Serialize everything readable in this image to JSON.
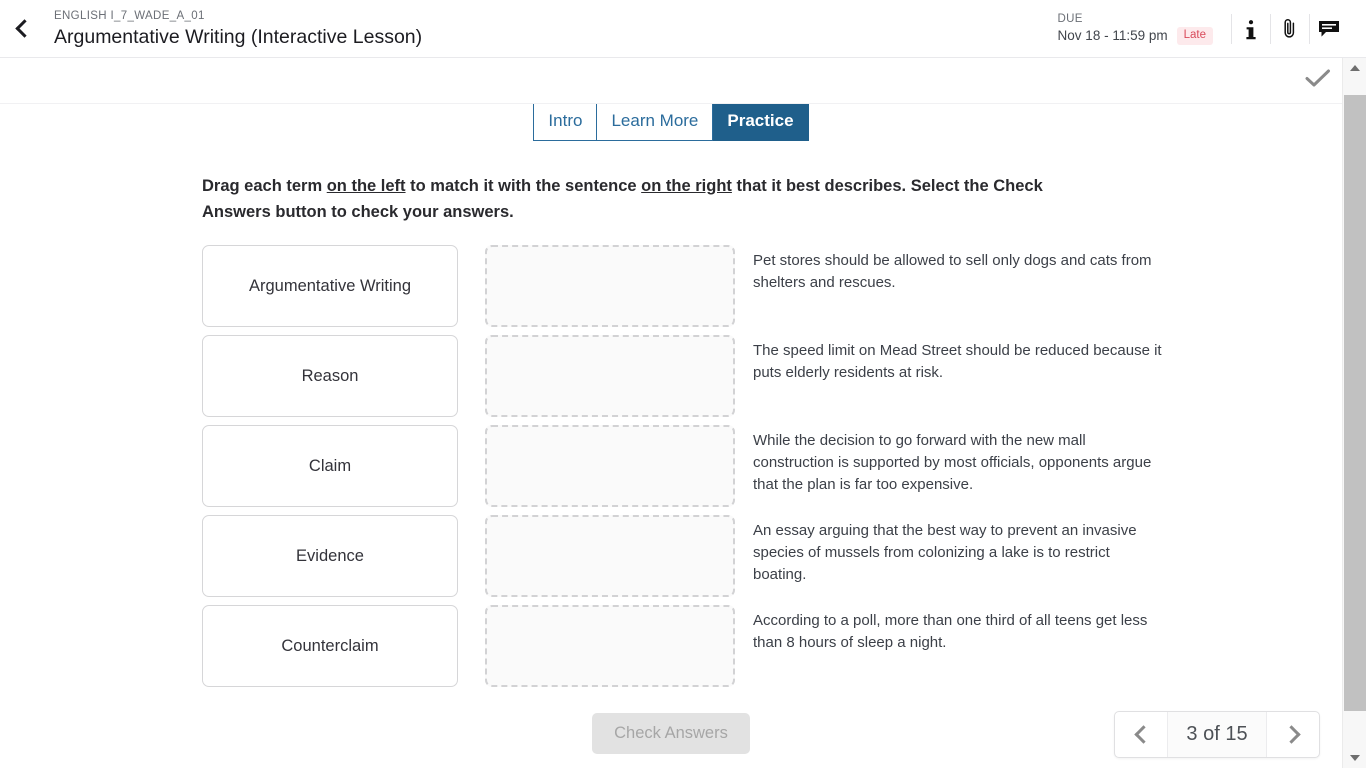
{
  "header": {
    "back_icon": "chevron-left-icon",
    "course_code": "ENGLISH I_7_WADE_A_01",
    "lesson_title": "Argumentative Writing (Interactive Lesson)",
    "due_label": "DUE",
    "due_date": "Nov 18 - 11:59 pm",
    "late_badge": "Late",
    "icons": [
      {
        "name": "info-icon",
        "glyph": "i"
      },
      {
        "name": "paperclip-icon",
        "glyph": "attachment"
      },
      {
        "name": "comment-icon",
        "glyph": "chat"
      }
    ]
  },
  "status": {
    "complete_check_icon": "check-icon",
    "check_color": "#8a8a8a"
  },
  "tabs": [
    {
      "label": "Intro",
      "active": false
    },
    {
      "label": "Learn More",
      "active": false
    },
    {
      "label": "Practice",
      "active": true
    }
  ],
  "instructions": {
    "part1": "Drag each term ",
    "underline1": "on the left",
    "part2": " to match it with the sentence ",
    "underline2": "on the right",
    "part3": " that it best describes. Select the Check Answers button to check your answers."
  },
  "terms": [
    {
      "label": "Argumentative Writing"
    },
    {
      "label": "Reason"
    },
    {
      "label": "Claim"
    },
    {
      "label": "Evidence"
    },
    {
      "label": "Counterclaim"
    }
  ],
  "drop_zones": [
    {
      "value": ""
    },
    {
      "value": ""
    },
    {
      "value": ""
    },
    {
      "value": ""
    },
    {
      "value": ""
    }
  ],
  "sentences": [
    {
      "text": "Pet stores should be allowed to sell only dogs and cats from shelters and rescues."
    },
    {
      "text": "The speed limit on Mead Street should be reduced because it puts elderly residents at risk."
    },
    {
      "text": "While the decision to go forward with the new mall construction is supported by most officials, opponents argue that the plan is far too expensive."
    },
    {
      "text": "An essay arguing that the best way to prevent an invasive species of mussels from colonizing a lake is to restrict boating."
    },
    {
      "text": "According to a poll, more than one third of all teens get less than 8 hours of sleep a night."
    }
  ],
  "check_answers": {
    "label": "Check Answers",
    "disabled": true
  },
  "pagination": {
    "prev_icon": "chevron-left-icon",
    "next_icon": "chevron-right-icon",
    "label": "3 of 15",
    "current": 3,
    "total": 15
  },
  "scrollbar": {
    "up_icon": "triangle-up-icon",
    "down_icon": "triangle-down-icon"
  },
  "colors": {
    "tab_active_bg": "#1f5f8b",
    "tab_border": "#2b6c9c",
    "late_badge_bg": "#fdeaec",
    "late_badge_text": "#d94a5a"
  }
}
